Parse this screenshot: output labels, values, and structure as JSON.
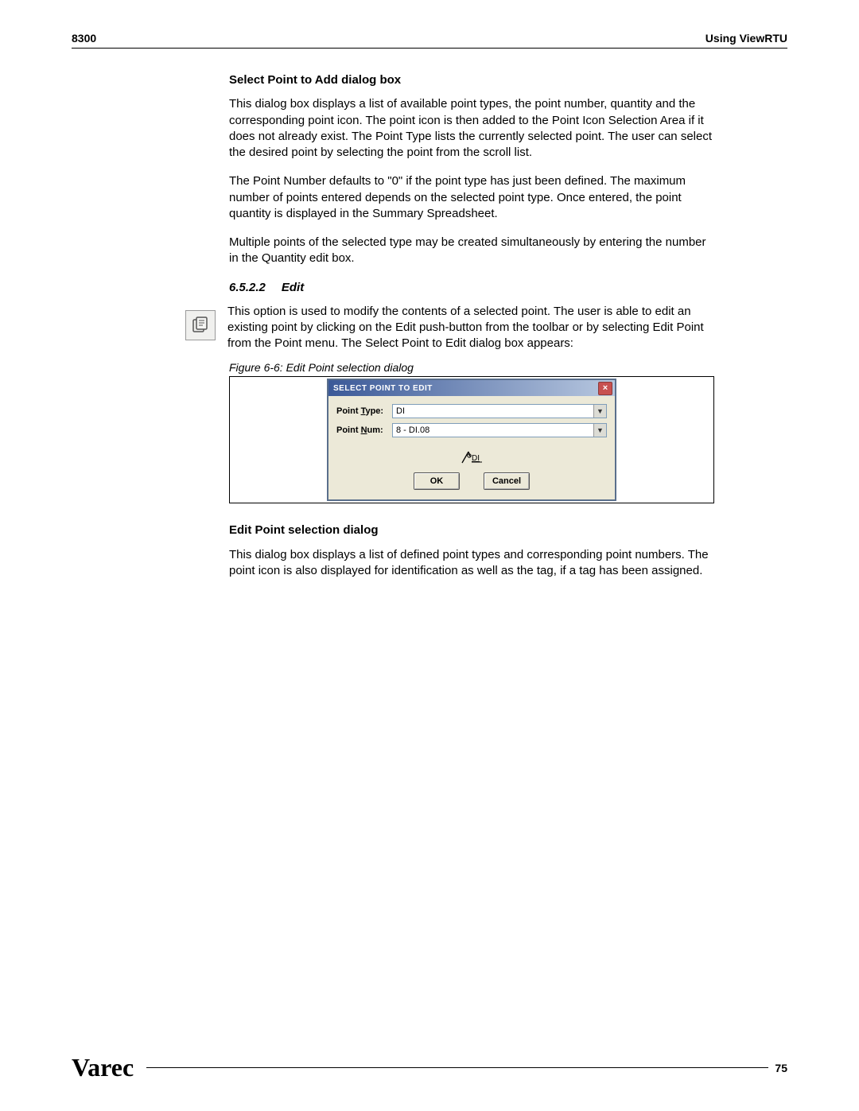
{
  "header": {
    "left": "8300",
    "right": "Using ViewRTU"
  },
  "section1": {
    "heading": "Select Point to Add dialog box",
    "p1": "This dialog box displays a list of available point types, the point number, quantity and the corresponding point icon. The point icon is then added to the Point Icon Selection Area if it does not already exist. The Point Type lists the currently selected point. The user can select the desired point by selecting the point from the scroll list.",
    "p2": "The Point Number defaults to \"0\" if the point type has just been defined. The maximum number of points entered depends on the selected point type. Once entered, the point quantity is displayed in the Summary Spreadsheet.",
    "p3": "Multiple points of the selected type may be created simultaneously by entering the number in the Quantity edit box."
  },
  "section2": {
    "num": "6.5.2.2",
    "title": "Edit",
    "p1": "This option is used to modify the contents of a selected point. The user is able to edit an existing point by clicking on the Edit push-button from the toolbar or by selecting Edit Point from the Point menu. The Select Point to Edit dialog box appears:"
  },
  "figure": {
    "caption": "Figure 6-6: Edit Point selection dialog",
    "dialog": {
      "title": "SELECT POINT TO EDIT",
      "close": "×",
      "label_type_pre": "Point ",
      "label_type_ul": "T",
      "label_type_post": "ype:",
      "value_type": "DI",
      "label_num_pre": "Point ",
      "label_num_ul": "N",
      "label_num_post": "um:",
      "value_num": "8 - DI.08",
      "icon_text": "DI",
      "ok": "OK",
      "cancel": "Cancel"
    }
  },
  "section3": {
    "heading": "Edit Point selection dialog",
    "p1": "This dialog box displays a list of defined point types and corresponding point numbers. The point icon is also displayed for identification as well as the tag, if a tag has been assigned."
  },
  "footer": {
    "logo": "Varec",
    "page": "75"
  }
}
